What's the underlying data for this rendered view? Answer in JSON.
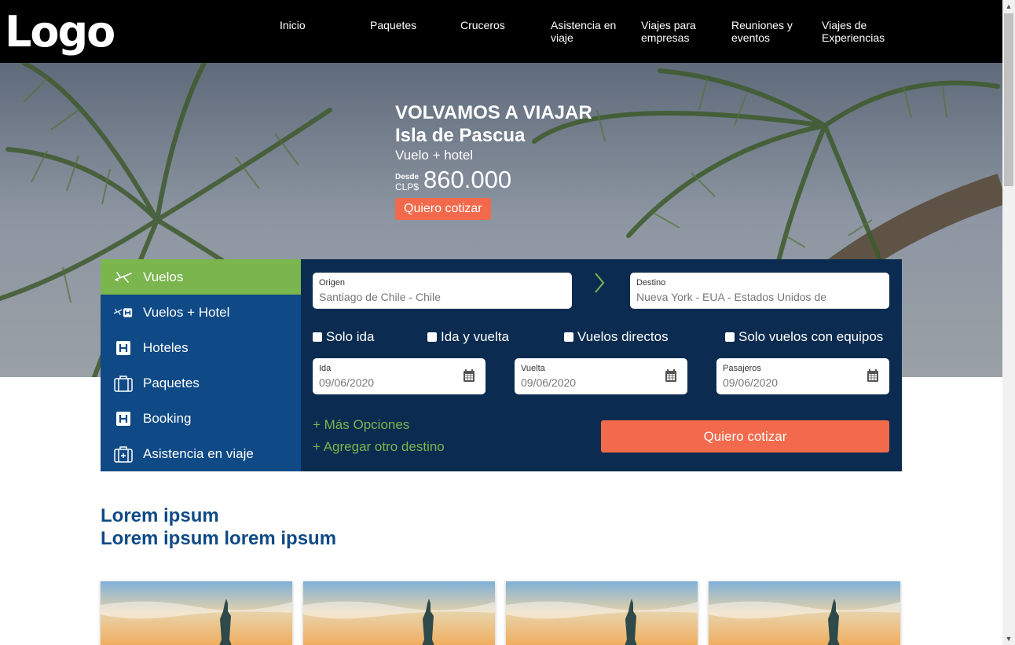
{
  "header": {
    "logo": "Logo",
    "nav": [
      "Inicio",
      "Paquetes",
      "Cruceros",
      "Asistencia en viaje",
      "Viajes para empresas",
      "Reuniones y eventos",
      "Viajes de Experiencias"
    ]
  },
  "hero": {
    "kicker": "VOLVAMOS A VIAJAR",
    "title": "Isla de Pascua",
    "subtitle": "Vuelo + hotel",
    "price_from": "Desde",
    "currency": "CLP$",
    "price": "860.000",
    "button": "Quiero cotizar"
  },
  "tabs": [
    {
      "label": "Vuelos",
      "icon": "plane-icon",
      "active": true
    },
    {
      "label": "Vuelos + Hotel",
      "icon": "plane-hotel-icon",
      "active": false
    },
    {
      "label": "Hoteles",
      "icon": "hotel-icon",
      "active": false
    },
    {
      "label": "Paquetes",
      "icon": "suitcase-icon",
      "active": false
    },
    {
      "label": "Booking",
      "icon": "booking-icon",
      "active": false
    },
    {
      "label": "Asistencia en viaje",
      "icon": "medical-case-icon",
      "active": false
    }
  ],
  "search": {
    "origin": {
      "label": "Origen",
      "value": "Santiago de Chile - Chile"
    },
    "destination": {
      "label": "Destino",
      "value": "Nueva York  - EUA - Estados Unidos de"
    },
    "options": [
      "Solo ida",
      "Ida y vuelta",
      "Vuelos directos",
      "Solo vuelos con equipos"
    ],
    "ida": {
      "label": "Ida",
      "value": "09/06/2020"
    },
    "vuelta": {
      "label": "Vuelta",
      "value": "09/06/2020"
    },
    "pasajeros": {
      "label": "Pasajeros",
      "value": "09/06/2020"
    },
    "more_options": "+ Más Opciones",
    "add_destination": "+ Agregar otro destino",
    "submit": "Quiero cotizar"
  },
  "section": {
    "title_line1": "Lorem ipsum",
    "title_line2": "Lorem ipsum lorem ipsum"
  },
  "colors": {
    "accent_orange": "#f26a4b",
    "accent_green": "#7ab54e",
    "tab_blue": "#0f4a86",
    "panel_navy": "#0b2c50"
  }
}
